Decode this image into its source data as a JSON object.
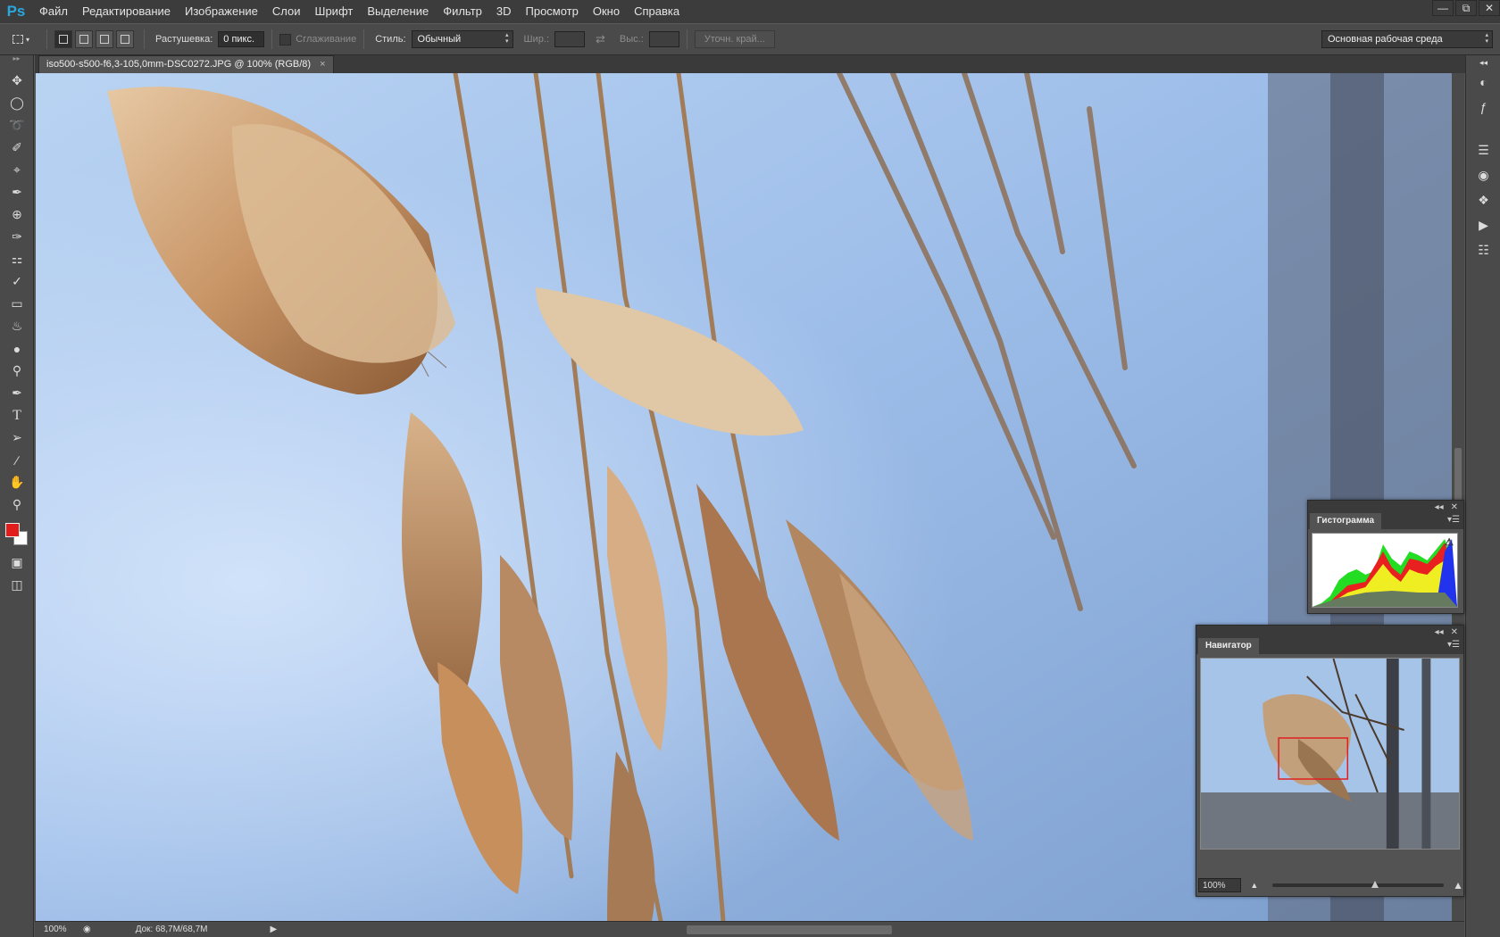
{
  "app": {
    "logo": "Ps"
  },
  "menu": [
    "Файл",
    "Редактирование",
    "Изображение",
    "Слои",
    "Шрифт",
    "Выделение",
    "Фильтр",
    "3D",
    "Просмотр",
    "Окно",
    "Справка"
  ],
  "options": {
    "feather_label": "Растушевка:",
    "feather_value": "0 пикс.",
    "antialias_label": "Сглаживание",
    "style_label": "Стиль:",
    "style_value": "Обычный",
    "width_label": "Шир.:",
    "height_label": "Выс.:",
    "refine_button": "Уточн. край...",
    "workspace": "Основная рабочая среда"
  },
  "document": {
    "tab_title": "iso500-s500-f6,3-105,0mm-DSC0272.JPG @ 100% (RGB/8)",
    "close": "×"
  },
  "status": {
    "zoom": "100%",
    "doc_info": "Док: 68,7M/68,7M"
  },
  "histogram": {
    "title": "Гистограмма"
  },
  "navigator": {
    "title": "Навигатор",
    "zoom": "100%",
    "zoom_level": 0.6
  },
  "colors": {
    "foreground": "#e21b1b",
    "background": "#ffffff",
    "accent": "#29a8e0"
  },
  "tools": [
    "move-icon",
    "marquee-icon",
    "lasso-icon",
    "quick-select-icon",
    "crop-icon",
    "eyedropper-icon",
    "healing-icon",
    "brush-icon",
    "stamp-icon",
    "history-brush-icon",
    "eraser-icon",
    "paint-bucket-icon",
    "blur-icon",
    "dodge-icon",
    "pen-icon",
    "type-icon",
    "path-select-icon",
    "line-icon",
    "hand-icon",
    "zoom-icon"
  ]
}
